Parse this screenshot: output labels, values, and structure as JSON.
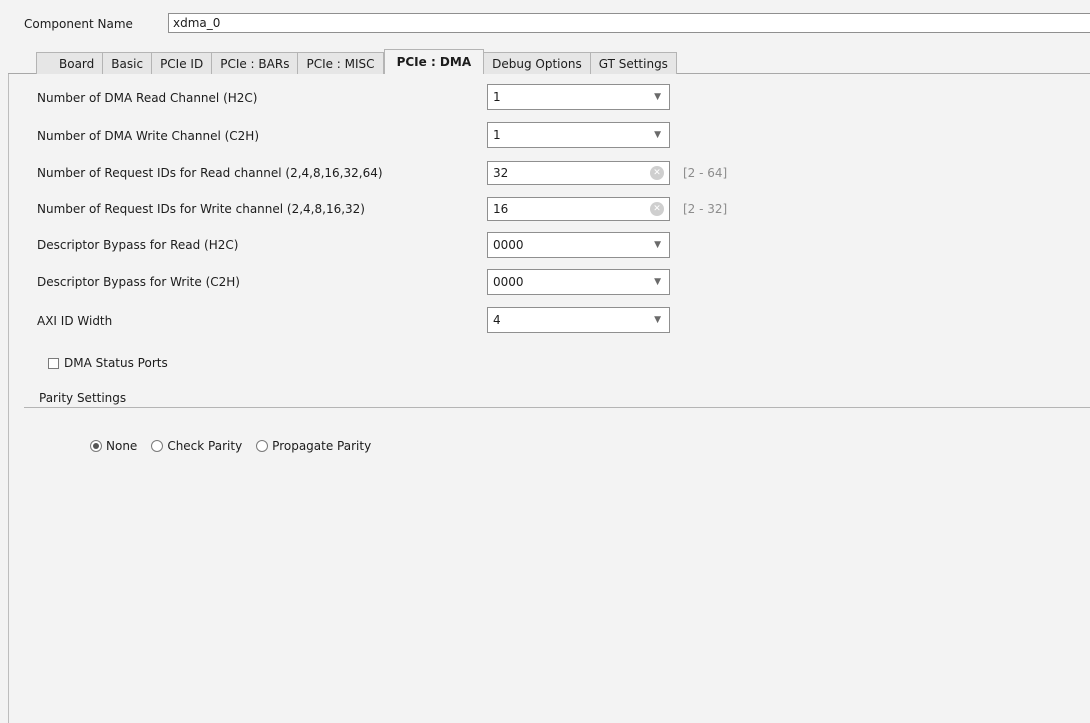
{
  "component": {
    "label": "Component Name",
    "value": "xdma_0"
  },
  "tabs": [
    {
      "label": "Board"
    },
    {
      "label": "Basic"
    },
    {
      "label": "PCIe ID"
    },
    {
      "label": "PCIe : BARs"
    },
    {
      "label": "PCIe : MISC"
    },
    {
      "label": "PCIe : DMA",
      "active": true
    },
    {
      "label": "Debug Options"
    },
    {
      "label": "GT Settings"
    }
  ],
  "fields": {
    "read_channel": {
      "label": "Number of DMA Read Channel (H2C)",
      "value": "1"
    },
    "write_channel": {
      "label": "Number of DMA Write Channel (C2H)",
      "value": "1"
    },
    "read_ids": {
      "label": "Number of Request IDs for Read channel (2,4,8,16,32,64)",
      "value": "32",
      "range": "[2 - 64]"
    },
    "write_ids": {
      "label": "Number of Request IDs for Write channel (2,4,8,16,32)",
      "value": "16",
      "range": "[2 - 32]"
    },
    "bypass_read": {
      "label": "Descriptor Bypass for Read (H2C)",
      "value": "0000"
    },
    "bypass_write": {
      "label": "Descriptor Bypass for Write (C2H)",
      "value": "0000"
    },
    "axi_id": {
      "label": "AXI ID Width",
      "value": "4"
    }
  },
  "status_ports": {
    "label": "DMA Status Ports",
    "checked": false
  },
  "parity": {
    "title": "Parity Settings",
    "options": [
      {
        "label": "None",
        "selected": true
      },
      {
        "label": "Check Parity",
        "selected": false
      },
      {
        "label": "Propagate Parity",
        "selected": false
      }
    ]
  },
  "icons": {
    "dropdown": "chevron-down-icon",
    "clear": "clear-icon"
  },
  "colors": {
    "background": "#f3f3f3",
    "range_text": "#8c8c8c"
  }
}
